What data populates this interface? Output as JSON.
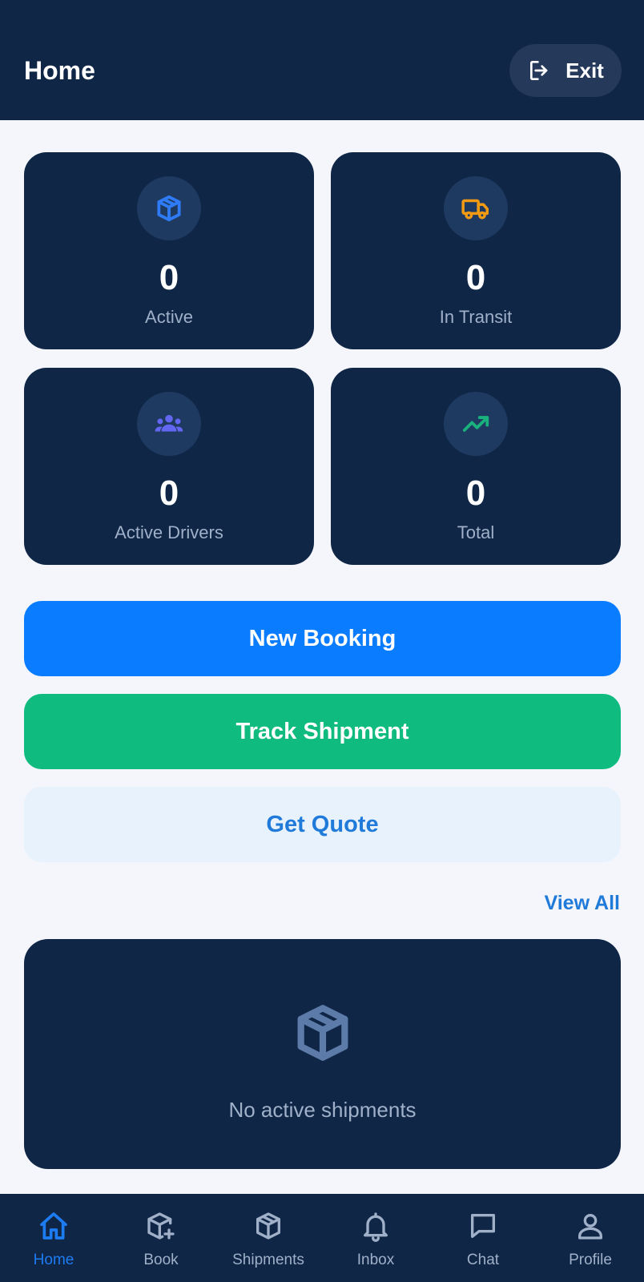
{
  "header": {
    "title": "Home",
    "exit_label": "Exit"
  },
  "stats": [
    {
      "value": "0",
      "label": "Active",
      "icon": "package-icon",
      "icon_color": "#2f7bf5"
    },
    {
      "value": "0",
      "label": "In Transit",
      "icon": "truck-icon",
      "icon_color": "#f29b12"
    },
    {
      "value": "0",
      "label": "Active Drivers",
      "icon": "users-icon",
      "icon_color": "#6366f1"
    },
    {
      "value": "0",
      "label": "Total",
      "icon": "trending-up-icon",
      "icon_color": "#19b27c"
    }
  ],
  "actions": {
    "new_booking": "New Booking",
    "track_shipment": "Track Shipment",
    "get_quote": "Get Quote"
  },
  "shipments": {
    "view_all": "View All",
    "empty_text": "No active shipments"
  },
  "nav": {
    "items": [
      {
        "label": "Home",
        "icon": "home-icon",
        "active": true
      },
      {
        "label": "Book",
        "icon": "package-plus-icon"
      },
      {
        "label": "Shipments",
        "icon": "package-icon"
      },
      {
        "label": "Inbox",
        "icon": "bell-icon"
      },
      {
        "label": "Chat",
        "icon": "chat-icon"
      },
      {
        "label": "Profile",
        "icon": "user-icon"
      }
    ]
  },
  "colors": {
    "navy": "#0f2647",
    "primary": "#0a7cff",
    "success": "#0fbb7f",
    "quote_bg": "#e8f2fd",
    "quote_text": "#1f7ad9",
    "page_bg": "#f4f6fb"
  }
}
